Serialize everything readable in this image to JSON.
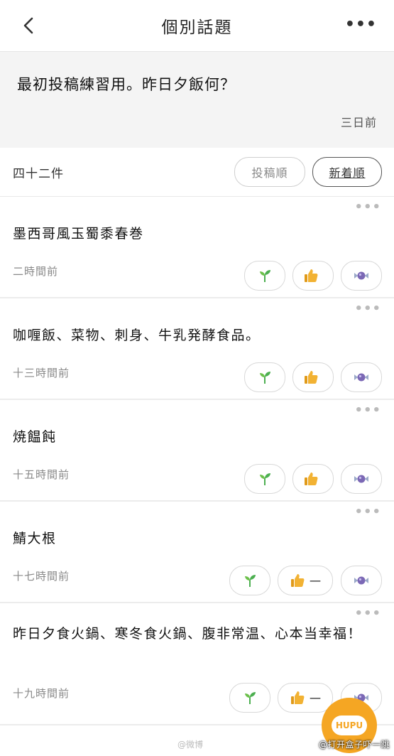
{
  "nav": {
    "title": "個別話題",
    "more": "•••"
  },
  "topic": {
    "text": "最初投稿練習用。昨日夕飯何？",
    "time": "三日前"
  },
  "list": {
    "count": "四十二件",
    "sort_post": "投稿順",
    "sort_new": "新着順"
  },
  "posts": [
    {
      "text": "墨西哥風玉蜀黍春巻",
      "time": "二時間前",
      "like_count": ""
    },
    {
      "text": "咖喱飯、菜物、刺身、牛乳発酵食品。",
      "time": "十三時間前",
      "like_count": ""
    },
    {
      "text": "焼饂飩",
      "time": "十五時間前",
      "like_count": ""
    },
    {
      "text": "鯖大根",
      "time": "十七時間前",
      "like_count": "一"
    },
    {
      "text": "昨日夕食火鍋、寒冬食火鍋、腹非常温、心本当幸福！",
      "time": "十九時間前",
      "like_count": "一"
    }
  ],
  "post_more": "•••",
  "icons": {
    "back": "chevron-left-icon",
    "sprout": "sprout-icon",
    "like": "thumbs-up-icon",
    "candy": "candy-icon"
  },
  "overlay": {
    "badge": "HUPU",
    "watermark": "@打开盒子吓一跳",
    "wm_left": "@微博"
  },
  "colors": {
    "accent": "#f5a623",
    "sprout": "#4caf50",
    "like": "#f2b233",
    "candy": "#7b68b5"
  }
}
